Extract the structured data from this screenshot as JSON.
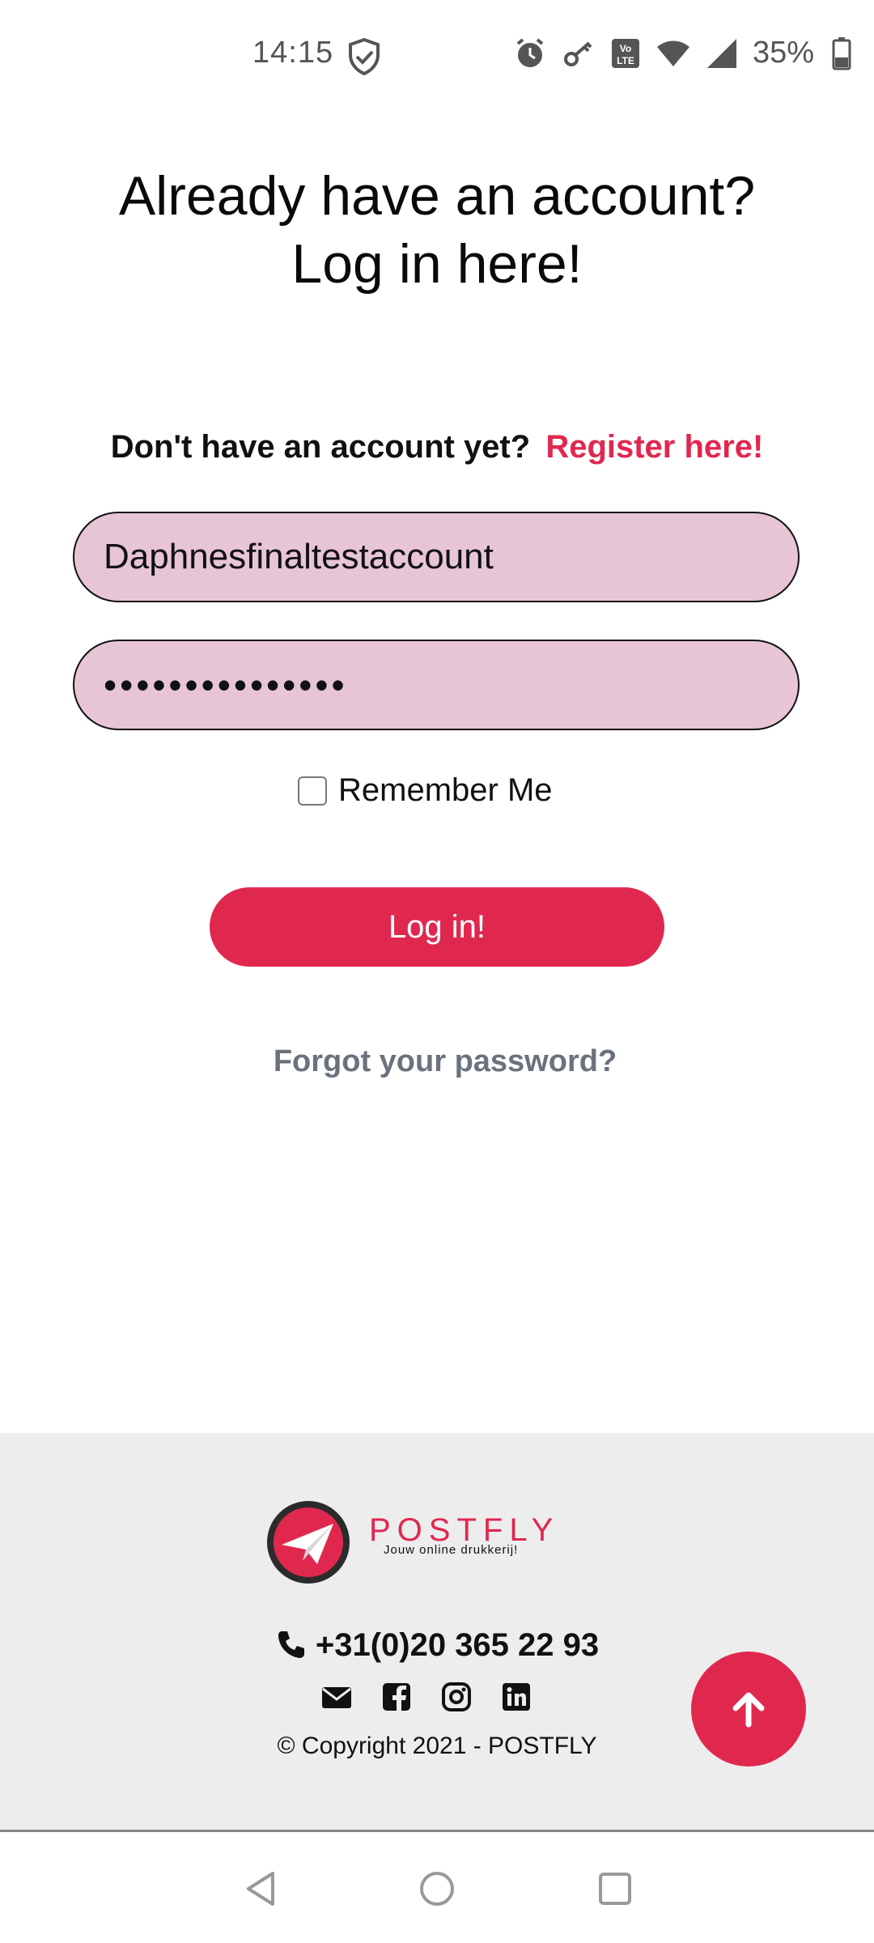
{
  "status_bar": {
    "time": "14:15",
    "battery": "35%",
    "icons": [
      "shield-check-icon",
      "alarm-icon",
      "key-icon",
      "volte-icon",
      "wifi-icon",
      "signal-icon",
      "battery-icon"
    ]
  },
  "page": {
    "title_line1": "Already have an account?",
    "title_line2": "Log in here!",
    "register_prompt": "Don't have an account yet?",
    "register_link": "Register here!"
  },
  "form": {
    "username_value": "Daphnesfinaltestaccount",
    "password_value": "•••••••••••••••",
    "remember_label": "Remember Me",
    "remember_checked": false,
    "login_label": "Log in!",
    "forgot_label": "Forgot your password?"
  },
  "footer": {
    "brand": "POSTFLY",
    "tagline": "Jouw online drukkerij!",
    "phone": "+31(0)20 365 22 93",
    "social_icons": [
      "email-icon",
      "facebook-icon",
      "instagram-icon",
      "linkedin-icon"
    ],
    "copyright": "© Copyright 2021 - POSTFLY"
  },
  "colors": {
    "accent": "#e0284f",
    "field_bg": "#e8c5d6",
    "muted_link": "#6a727d",
    "footer_bg": "#ededed"
  },
  "nav_bar": {
    "icons": [
      "back-icon",
      "home-icon",
      "recents-icon"
    ]
  }
}
